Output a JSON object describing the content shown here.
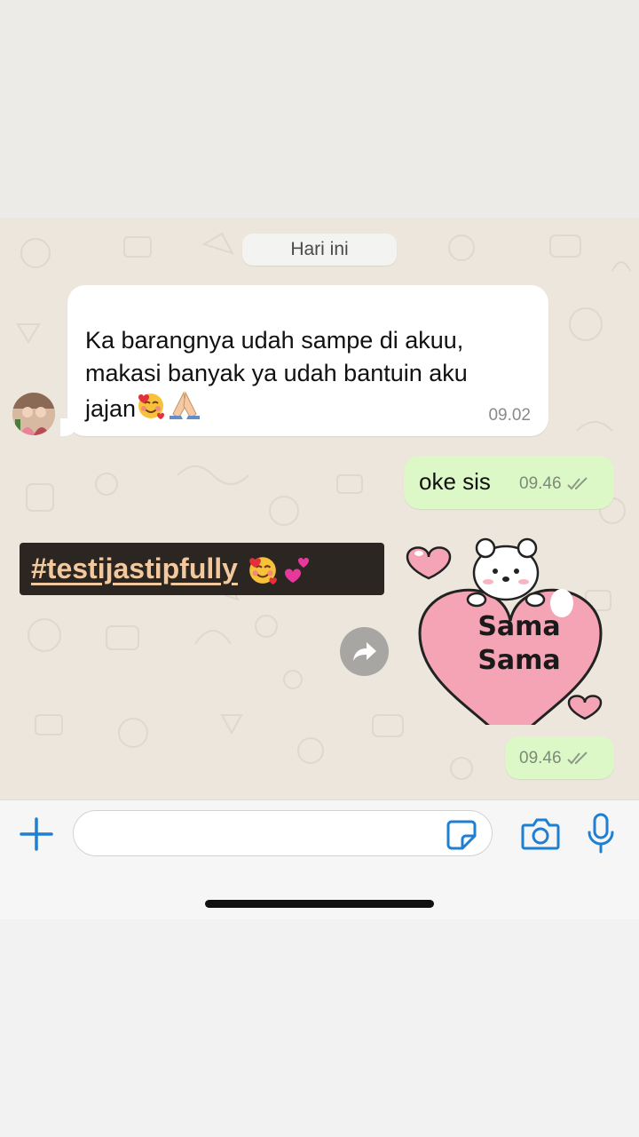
{
  "chat": {
    "date_divider": "Hari ini",
    "incoming": {
      "text": "Ka barangnya udah sampe di akuu,\nmakasi banyak ya udah bantuin aku\njajan",
      "emojis": [
        "smiling-face-with-hearts",
        "folded-hands"
      ],
      "time": "09.02"
    },
    "outgoing": {
      "text": "oke sis",
      "time": "09.46",
      "status": "read-double-check"
    },
    "sticker": {
      "line1": "Sama",
      "line2": "Sama",
      "time": "09.46",
      "status": "read-double-check"
    }
  },
  "overlay": {
    "hashtag": "#testijastipfully",
    "emojis": [
      "smiling-face-with-hearts",
      "two-hearts"
    ]
  },
  "composer": {
    "placeholder": "",
    "value": ""
  },
  "colors": {
    "outgoing_bubble": "#dcf8c6",
    "incoming_bubble": "#ffffff",
    "chat_background": "#ede6dc",
    "icon_blue": "#1f7fd1",
    "hashtag_text": "#f2c89f",
    "hashtag_bg": "#2b2621",
    "sticker_heart": "#f4a4b4"
  }
}
